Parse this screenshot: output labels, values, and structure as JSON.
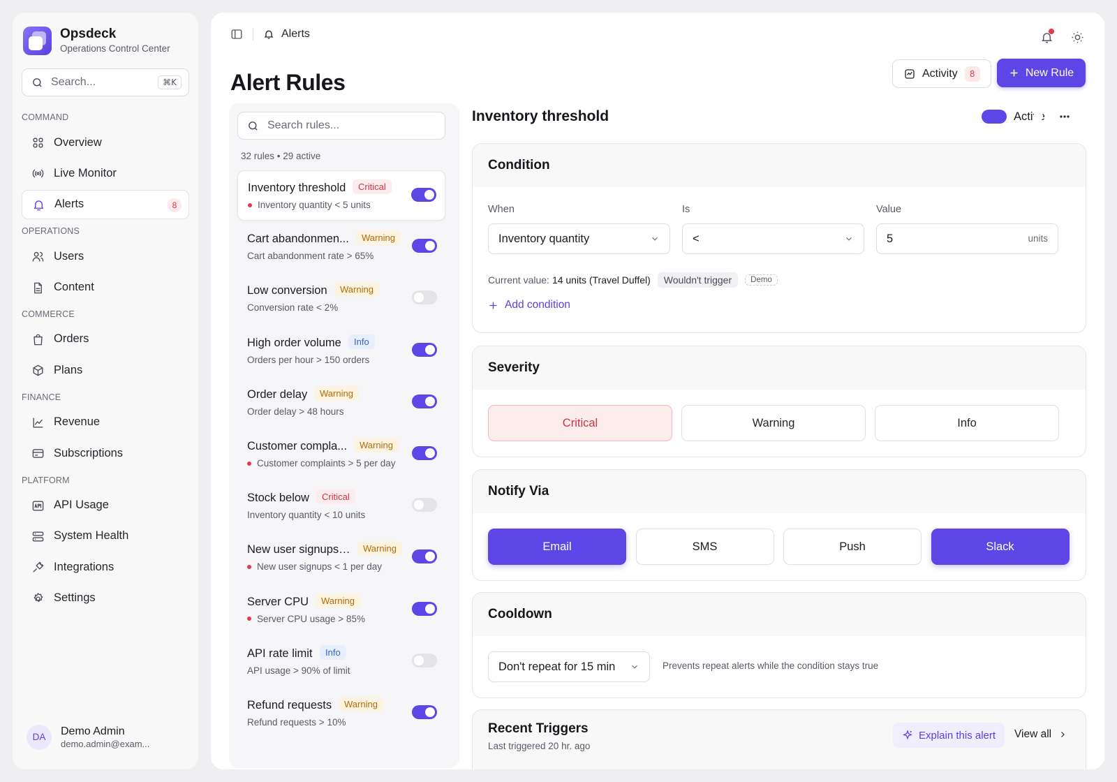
{
  "app": {
    "name": "Opsdeck",
    "subtitle": "Operations Control Center"
  },
  "sidebar": {
    "search_placeholder": "Search...",
    "search_shortcut": "⌘K",
    "sections": [
      {
        "label": "COMMAND",
        "items": [
          {
            "label": "Overview",
            "icon": "grid-icon"
          },
          {
            "label": "Live Monitor",
            "icon": "broadcast-icon"
          },
          {
            "label": "Alerts",
            "icon": "bell-icon",
            "badge": "8",
            "active": true
          }
        ]
      },
      {
        "label": "OPERATIONS",
        "items": [
          {
            "label": "Users",
            "icon": "users-icon"
          },
          {
            "label": "Content",
            "icon": "file-icon"
          }
        ]
      },
      {
        "label": "COMMERCE",
        "items": [
          {
            "label": "Orders",
            "icon": "shopping-bag-icon"
          },
          {
            "label": "Plans",
            "icon": "package-icon"
          }
        ]
      },
      {
        "label": "FINANCE",
        "items": [
          {
            "label": "Revenue",
            "icon": "chart-line-icon"
          },
          {
            "label": "Subscriptions",
            "icon": "credit-card-icon"
          }
        ]
      },
      {
        "label": "PLATFORM",
        "items": [
          {
            "label": "API Usage",
            "icon": "api-icon"
          },
          {
            "label": "System Health",
            "icon": "server-icon"
          },
          {
            "label": "Integrations",
            "icon": "plug-icon"
          },
          {
            "label": "Settings",
            "icon": "gear-icon"
          }
        ]
      }
    ]
  },
  "user": {
    "initials": "DA",
    "name": "Demo Admin",
    "email": "demo.admin@exam..."
  },
  "header": {
    "breadcrumb": "Alerts",
    "title": "Alert Rules",
    "activity_label": "Activity",
    "activity_count": "8",
    "new_rule_label": "New Rule"
  },
  "rules_list": {
    "search_placeholder": "Search rules...",
    "count_text": "32 rules • 29 active",
    "rules": [
      {
        "name": "Inventory threshold",
        "severity": "Critical",
        "level": "critical",
        "desc": "Inventory quantity < 5 units",
        "dot": true,
        "enabled": true,
        "selected": true
      },
      {
        "name": "Cart abandonmen...",
        "severity": "Warning",
        "level": "warning",
        "desc": "Cart abandonment rate > 65%",
        "dot": false,
        "enabled": true
      },
      {
        "name": "Low conversion",
        "severity": "Warning",
        "level": "warning",
        "desc": "Conversion rate < 2%",
        "dot": false,
        "enabled": false
      },
      {
        "name": "High order volume",
        "severity": "Info",
        "level": "info",
        "desc": "Orders per hour > 150 orders",
        "dot": false,
        "enabled": true
      },
      {
        "name": "Order delay",
        "severity": "Warning",
        "level": "warning",
        "desc": "Order delay > 48 hours",
        "dot": false,
        "enabled": true
      },
      {
        "name": "Customer compla...",
        "severity": "Warning",
        "level": "warning",
        "desc": "Customer complaints > 5 per day",
        "dot": true,
        "enabled": true
      },
      {
        "name": "Stock below",
        "severity": "Critical",
        "level": "critical",
        "desc": "Inventory quantity < 10 units",
        "dot": false,
        "enabled": false
      },
      {
        "name": "New user signups ...",
        "severity": "Warning",
        "level": "warning",
        "desc": "New user signups < 1 per day",
        "dot": true,
        "enabled": true
      },
      {
        "name": "Server CPU",
        "severity": "Warning",
        "level": "warning",
        "desc": "Server CPU usage > 85%",
        "dot": true,
        "enabled": true
      },
      {
        "name": "API rate limit",
        "severity": "Info",
        "level": "info",
        "desc": "API usage > 90% of limit",
        "dot": false,
        "enabled": false
      },
      {
        "name": "Refund requests",
        "severity": "Warning",
        "level": "warning",
        "desc": "Refund requests > 10%",
        "dot": false,
        "enabled": true
      }
    ]
  },
  "detail": {
    "title": "Inventory threshold",
    "active_label": "Active",
    "condition": {
      "heading": "Condition",
      "when_label": "When",
      "when_value": "Inventory quantity",
      "is_label": "Is",
      "is_value": "<",
      "value_label": "Value",
      "value": "5",
      "value_unit": "units",
      "current_prefix": "Current value:",
      "current_value": "14 units (Travel Duffel)",
      "trigger_status": "Wouldn't trigger",
      "demo_tag": "Demo",
      "add_condition": "Add condition"
    },
    "severity": {
      "heading": "Severity",
      "options": [
        "Critical",
        "Warning",
        "Info"
      ],
      "selected": "Critical"
    },
    "notify": {
      "heading": "Notify Via",
      "channels": [
        {
          "label": "Email",
          "on": true
        },
        {
          "label": "SMS",
          "on": false
        },
        {
          "label": "Push",
          "on": false
        },
        {
          "label": "Slack",
          "on": true
        }
      ]
    },
    "cooldown": {
      "heading": "Cooldown",
      "value": "Don't repeat for 15 min",
      "help": "Prevents repeat alerts while the condition stays true"
    },
    "recent": {
      "heading": "Recent Triggers",
      "subtitle": "Last triggered 20 hr. ago",
      "explain_label": "Explain this alert",
      "view_all": "View all"
    }
  },
  "colors": {
    "accent": "#5e46e6",
    "critical": "#c93743",
    "warning": "#b36b06",
    "info": "#3a64c7"
  }
}
